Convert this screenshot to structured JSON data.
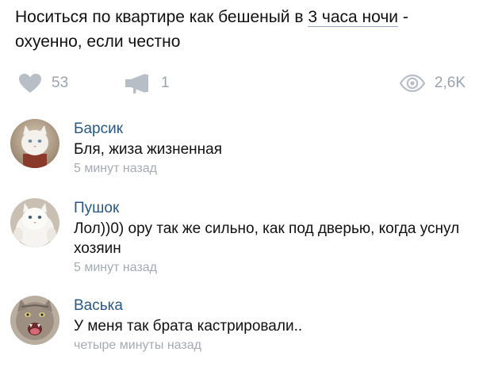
{
  "post": {
    "text_before": "Носиться по квартире как бешеный в ",
    "text_link": "3 часа ночи",
    "text_after": " - охуенно, если честно"
  },
  "stats": {
    "likes": "53",
    "reposts": "1",
    "views": "2,6K"
  },
  "icons": {
    "like": "heart-icon",
    "share": "megaphone-icon",
    "views": "eye-icon"
  },
  "colors": {
    "author": "#2a5885",
    "muted": "#a4abb3",
    "icon": "#b7bec6"
  },
  "comments": [
    {
      "author": "Барсик",
      "text": "Бля, жиза жизненная",
      "time": "5 минут назад"
    },
    {
      "author": "Пушок",
      "text": "Лол))0) ору так же сильно, как под дверью, когда уснул хозяин",
      "time": "5 минут назад"
    },
    {
      "author": "Васька",
      "text": "У меня так брата кастрировали..",
      "time": "четыре минуты назад"
    }
  ]
}
